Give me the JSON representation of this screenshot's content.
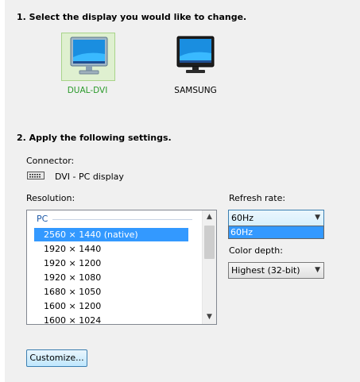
{
  "section1": {
    "title": "1. Select the display you would like to change."
  },
  "displays": [
    {
      "label": "DUAL-DVI",
      "selected": true
    },
    {
      "label": "SAMSUNG",
      "selected": false
    }
  ],
  "section2": {
    "title": "2. Apply the following settings."
  },
  "connector": {
    "label": "Connector:",
    "value": "DVI - PC display",
    "icon": "dvi-connector-icon"
  },
  "resolution": {
    "label": "Resolution:",
    "group": "PC",
    "items": [
      {
        "label": "2560 × 1440 (native)",
        "selected": true
      },
      {
        "label": "1920 × 1440"
      },
      {
        "label": "1920 × 1200"
      },
      {
        "label": "1920 × 1080"
      },
      {
        "label": "1680 × 1050"
      },
      {
        "label": "1600 × 1200"
      },
      {
        "label": "1600 × 1024"
      }
    ]
  },
  "refresh_rate": {
    "label": "Refresh rate:",
    "value": "60Hz",
    "options": [
      "60Hz"
    ]
  },
  "color_depth": {
    "label": "Color depth:",
    "value": "Highest (32-bit)"
  },
  "customize_button": "Customize...",
  "colors": {
    "selected_label": "#2b9a2b",
    "selection": "#3399ff",
    "group_header": "#1e5aa8"
  }
}
